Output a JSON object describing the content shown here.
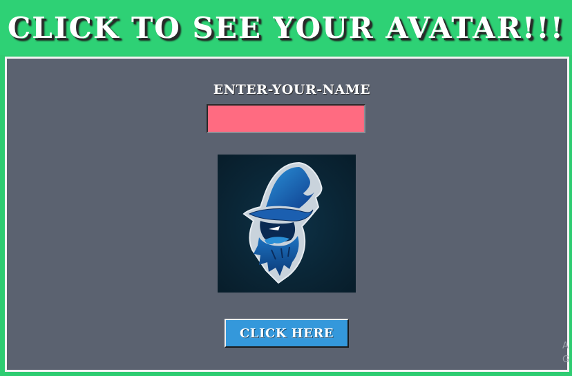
{
  "header": {
    "title": "CLICK TO SEE YOUR AVATAR!!!"
  },
  "form": {
    "name_label": "ENTER-YOUR-NAME",
    "name_value": "",
    "name_placeholder": ""
  },
  "avatar": {
    "icon": "wizard-mascot-icon"
  },
  "button": {
    "label": "CLICK HERE"
  },
  "corner": {
    "line1": "A",
    "line2": "G"
  },
  "colors": {
    "header_bg": "#2ed175",
    "panel_bg": "#5b6270",
    "input_bg": "#ff6b81",
    "button_bg": "#3498db",
    "avatar_bg": "#0a2535"
  }
}
